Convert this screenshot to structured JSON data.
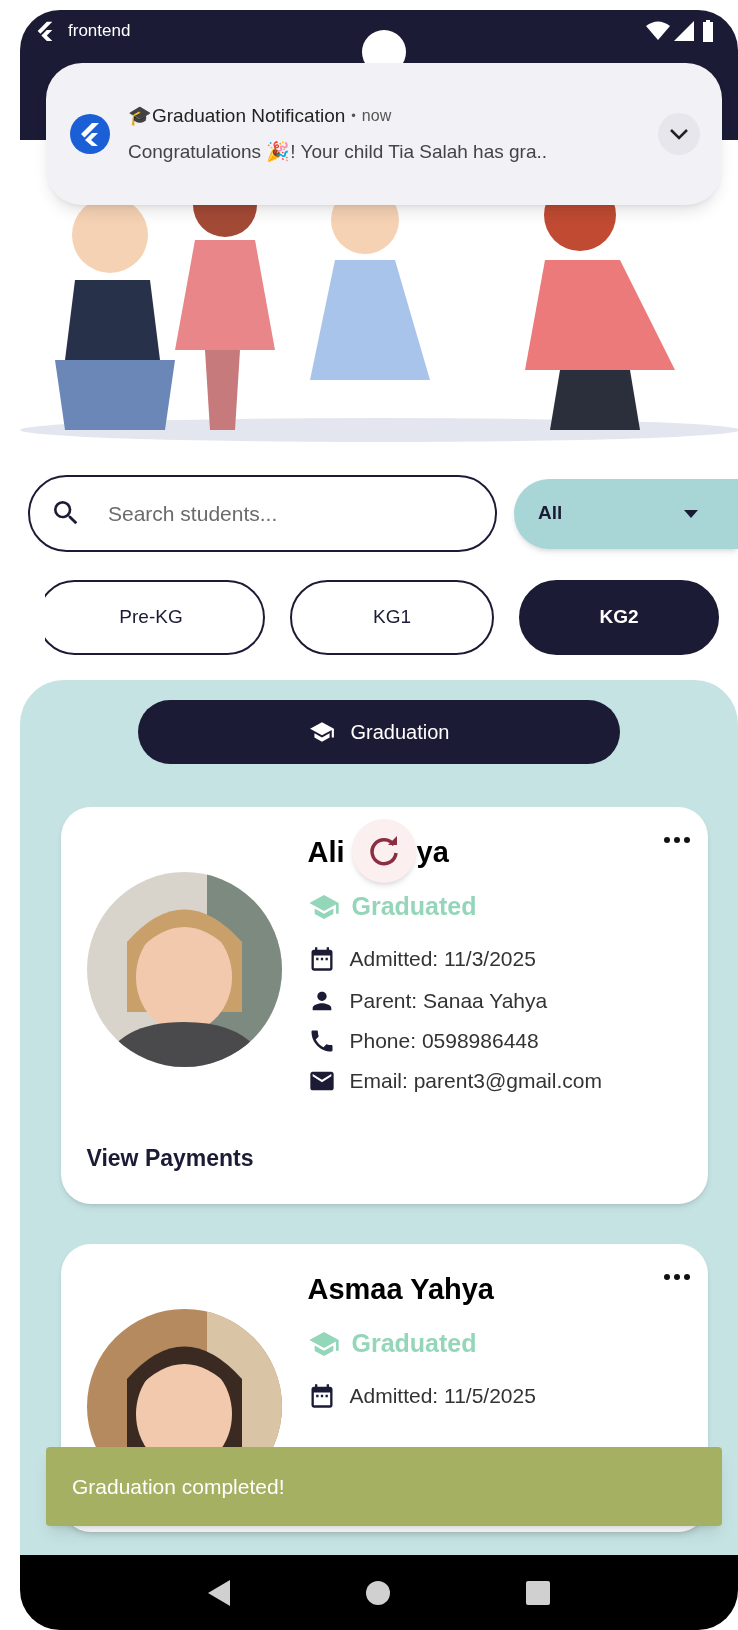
{
  "status_bar": {
    "app": "frontend"
  },
  "notification": {
    "title": "🎓Graduation Notification",
    "separator": "•",
    "time": "now",
    "body": "Congratulations 🎉! Your child Tia Salah has gra.."
  },
  "search": {
    "placeholder": "Search students..."
  },
  "filter": {
    "value": "All"
  },
  "chips": [
    {
      "label": "Pre-KG",
      "selected": false
    },
    {
      "label": "KG1",
      "selected": false
    },
    {
      "label": "KG2",
      "selected": true
    }
  ],
  "graduation_button": {
    "label": "Graduation"
  },
  "students": [
    {
      "name_parts": [
        "Ali",
        "ya"
      ],
      "loading": true,
      "status": "Graduated",
      "details": [
        {
          "kind": "admitted",
          "text": "Admitted: 11/3/2025"
        },
        {
          "kind": "parent",
          "text": "Parent: Sanaa Yahya"
        },
        {
          "kind": "phone",
          "text": "Phone: 0598986448"
        },
        {
          "kind": "email",
          "text": "Email: parent3@gmail.com"
        }
      ],
      "action": "View Payments"
    },
    {
      "name_parts": [
        "Asmaa Yahya"
      ],
      "loading": false,
      "status": "Graduated",
      "details": [
        {
          "kind": "admitted",
          "text": "Admitted: 11/5/2025"
        }
      ]
    }
  ],
  "snackbar": {
    "message": "Graduation completed!"
  }
}
